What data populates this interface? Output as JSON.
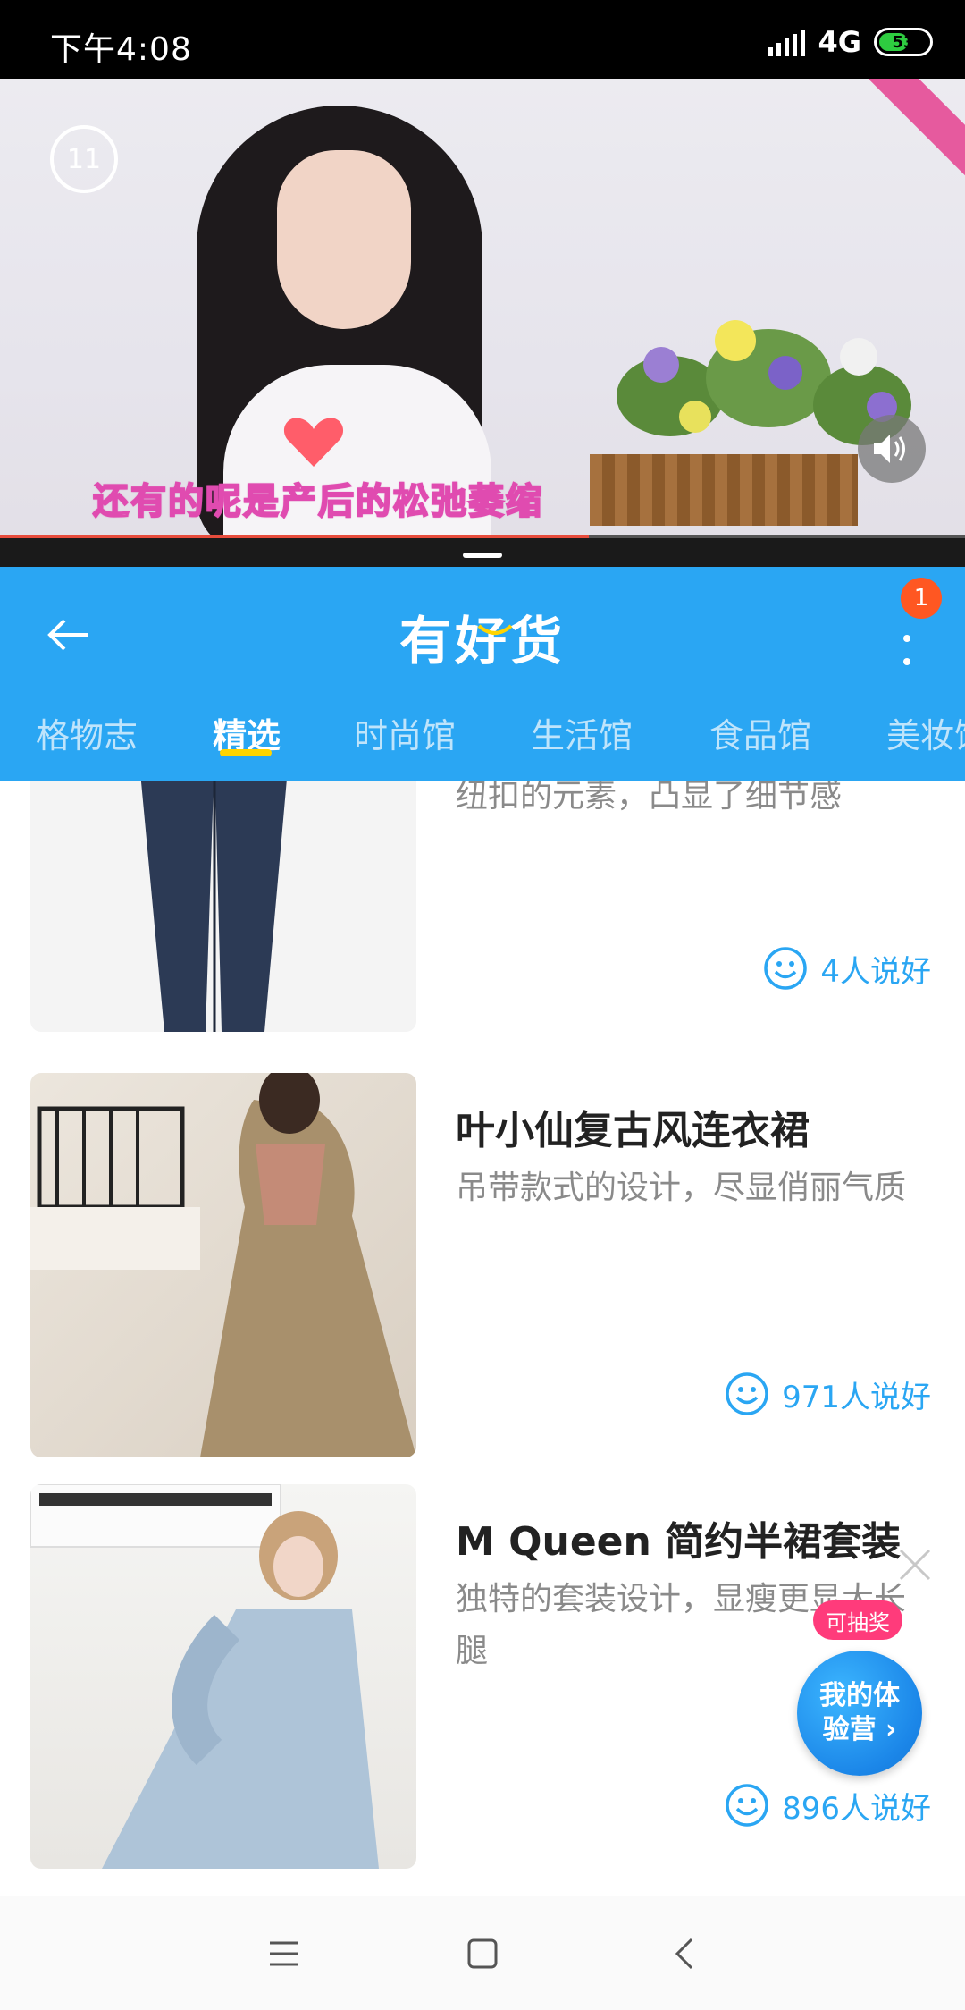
{
  "status_bar": {
    "time": "下午4:08",
    "network": "4G",
    "battery": "53"
  },
  "video": {
    "counter": "11",
    "subtitle": "还有的呢是产后的松弛萎缩",
    "progress": 0.61
  },
  "header": {
    "title": "有好货",
    "notification_count": "1",
    "tabs": [
      {
        "label": "格物志",
        "active": false
      },
      {
        "label": "精选",
        "active": true
      },
      {
        "label": "时尚馆",
        "active": false
      },
      {
        "label": "生活馆",
        "active": false
      },
      {
        "label": "食品馆",
        "active": false
      },
      {
        "label": "美妆馆",
        "active": false
      }
    ]
  },
  "feed": {
    "items": [
      {
        "title": "",
        "desc": "纽扣的元素，凸显了细节感",
        "likes": "4人说好"
      },
      {
        "title": "叶小仙复古风连衣裙",
        "desc": "吊带款式的设计，尽显俏丽气质",
        "likes": "971人说好"
      },
      {
        "title": "M Queen 简约半裙套装",
        "desc": "独特的套装设计，显瘦更显大长腿",
        "likes": "896人说好"
      }
    ]
  },
  "floating": {
    "badge": "可抽奖",
    "line1": "我的体",
    "line2": "验营"
  },
  "colors": {
    "brand": "#2aa6f3",
    "tab_indicator": "#ffd400",
    "badge": "#ff5722"
  }
}
